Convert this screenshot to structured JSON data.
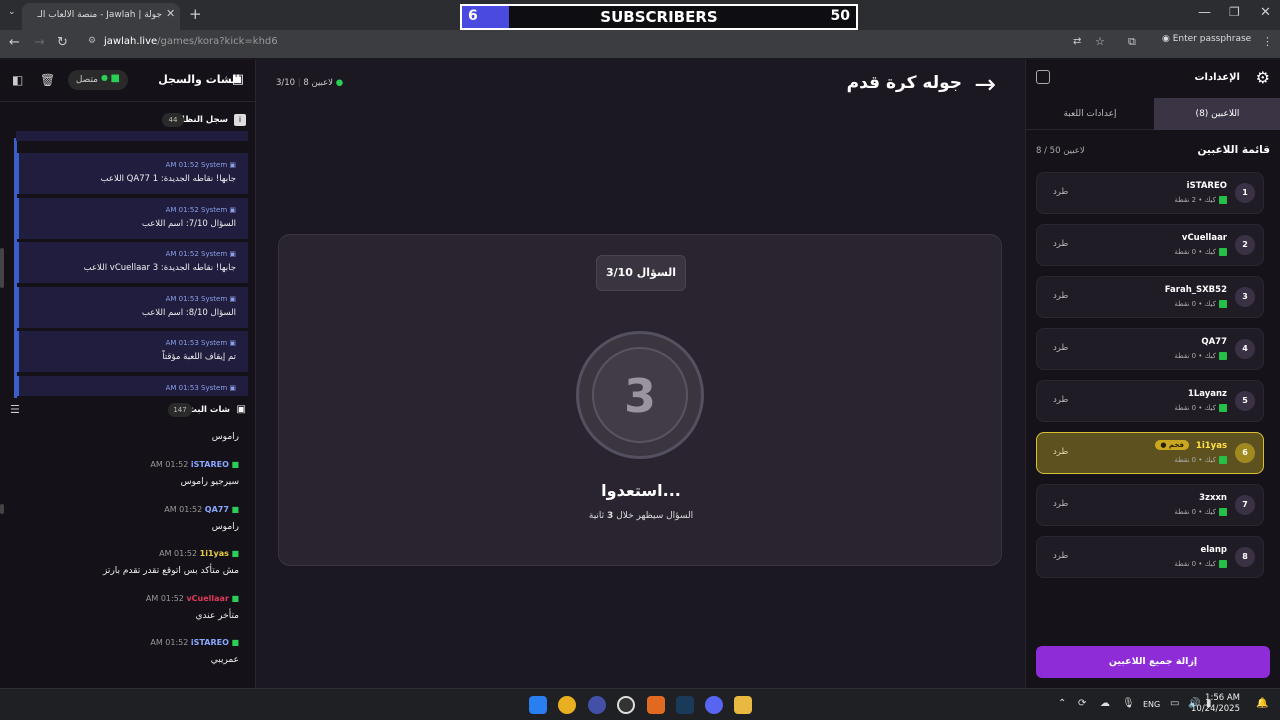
{
  "browser": {
    "tab_title": "جولة | Jawlah - منصة الألعاب الـ",
    "url_host": "jawlah.live",
    "url_path": "/games/kora?kick=khd6",
    "passphrase_label": "Enter passphrase"
  },
  "overlay": {
    "left_value": "6",
    "label": "SUBSCRIBERS",
    "right_value": "50",
    "fill_fraction": 0.12
  },
  "left_panel": {
    "title": "الشات والسجل",
    "status": "متصل",
    "system_log_title": "سجل النظام",
    "system_log_count": "44",
    "system_entries": [
      {
        "author": "System",
        "time": "AM 01:52",
        "text": "اللاعب QA77 جابها! نقاطه الجديدة: 1"
      },
      {
        "author": "System",
        "time": "AM 01:52",
        "text": "السؤال 7/10: اسم اللاعب"
      },
      {
        "author": "System",
        "time": "AM 01:52",
        "text": "اللاعب vCuellaar جابها! نقاطه الجديدة: 3"
      },
      {
        "author": "System",
        "time": "AM 01:53",
        "text": "السؤال 8/10: اسم اللاعب"
      },
      {
        "author": "System",
        "time": "AM 01:53",
        "text": "تم إيقاف اللعبة مؤقتاً"
      },
      {
        "author": "System",
        "time": "AM 01:53",
        "text": ""
      }
    ],
    "chat_title": "شات البث",
    "chat_count": "147",
    "chat_top": "راموس",
    "chat_messages": [
      {
        "user": "iSTAREO",
        "time": "AM 01:52",
        "text": "سيرجيو راموس",
        "color": "#8aa8ff"
      },
      {
        "user": "QA77",
        "time": "AM 01:52",
        "text": "راموس",
        "color": "#8aa8ff"
      },
      {
        "user": "1i1yas",
        "time": "AM 01:52",
        "text": "مش متأكد بس اتوقع تقدر تقدم بارتز",
        "color": "#e8d040"
      },
      {
        "user": "vCuellaar",
        "time": "AM 01:52",
        "text": "متأخر عندي",
        "color": "#e03a5a"
      },
      {
        "user": "iSTAREO",
        "time": "AM 01:52",
        "text": "عمريبي",
        "color": "#8aa8ff"
      }
    ]
  },
  "main": {
    "title": "جوله كرة قدم",
    "players_online": "8 لاعبين",
    "question_progress": "السؤال 3/10",
    "question_top": "3/10",
    "countdown": "3",
    "ready_text": "استعدوا...",
    "ready_sub_before": "السؤال سيظهر خلال",
    "ready_sub_num": "3",
    "ready_sub_after": "ثانية"
  },
  "right_panel": {
    "title": "الإعدادات",
    "tab_players": "اللاعبين (8)",
    "tab_game_settings": "إعدادات اللعبة",
    "list_title": "قائمة اللاعبين",
    "list_count": "8 / 50 لاعبين",
    "kick_label": "طرد",
    "players": [
      {
        "n": "1",
        "name": "iSTAREO",
        "sub": "كيك • 2 نقطة"
      },
      {
        "n": "2",
        "name": "vCuellaar",
        "sub": "كيك • 0 نقطة"
      },
      {
        "n": "3",
        "name": "Farah_SXB52",
        "sub": "كيك • 0 نقطة"
      },
      {
        "n": "4",
        "name": "QA77",
        "sub": "كيك • 0 نقطة"
      },
      {
        "n": "5",
        "name": "1Layanz",
        "sub": "كيك • 0 نقطة"
      },
      {
        "n": "6",
        "name": "1i1yas",
        "sub": "كيك • 0 نقطة",
        "badge": "● فخم"
      },
      {
        "n": "7",
        "name": "3zxxn",
        "sub": "كيك • 0 نقطة"
      },
      {
        "n": "8",
        "name": "elanp",
        "sub": "كيك • 0 نقطة"
      }
    ],
    "clear_button": "إزالة جميع اللاعبين"
  },
  "taskbar": {
    "lang": "ENG",
    "time": "1:56 AM",
    "date": "10/24/2025"
  }
}
